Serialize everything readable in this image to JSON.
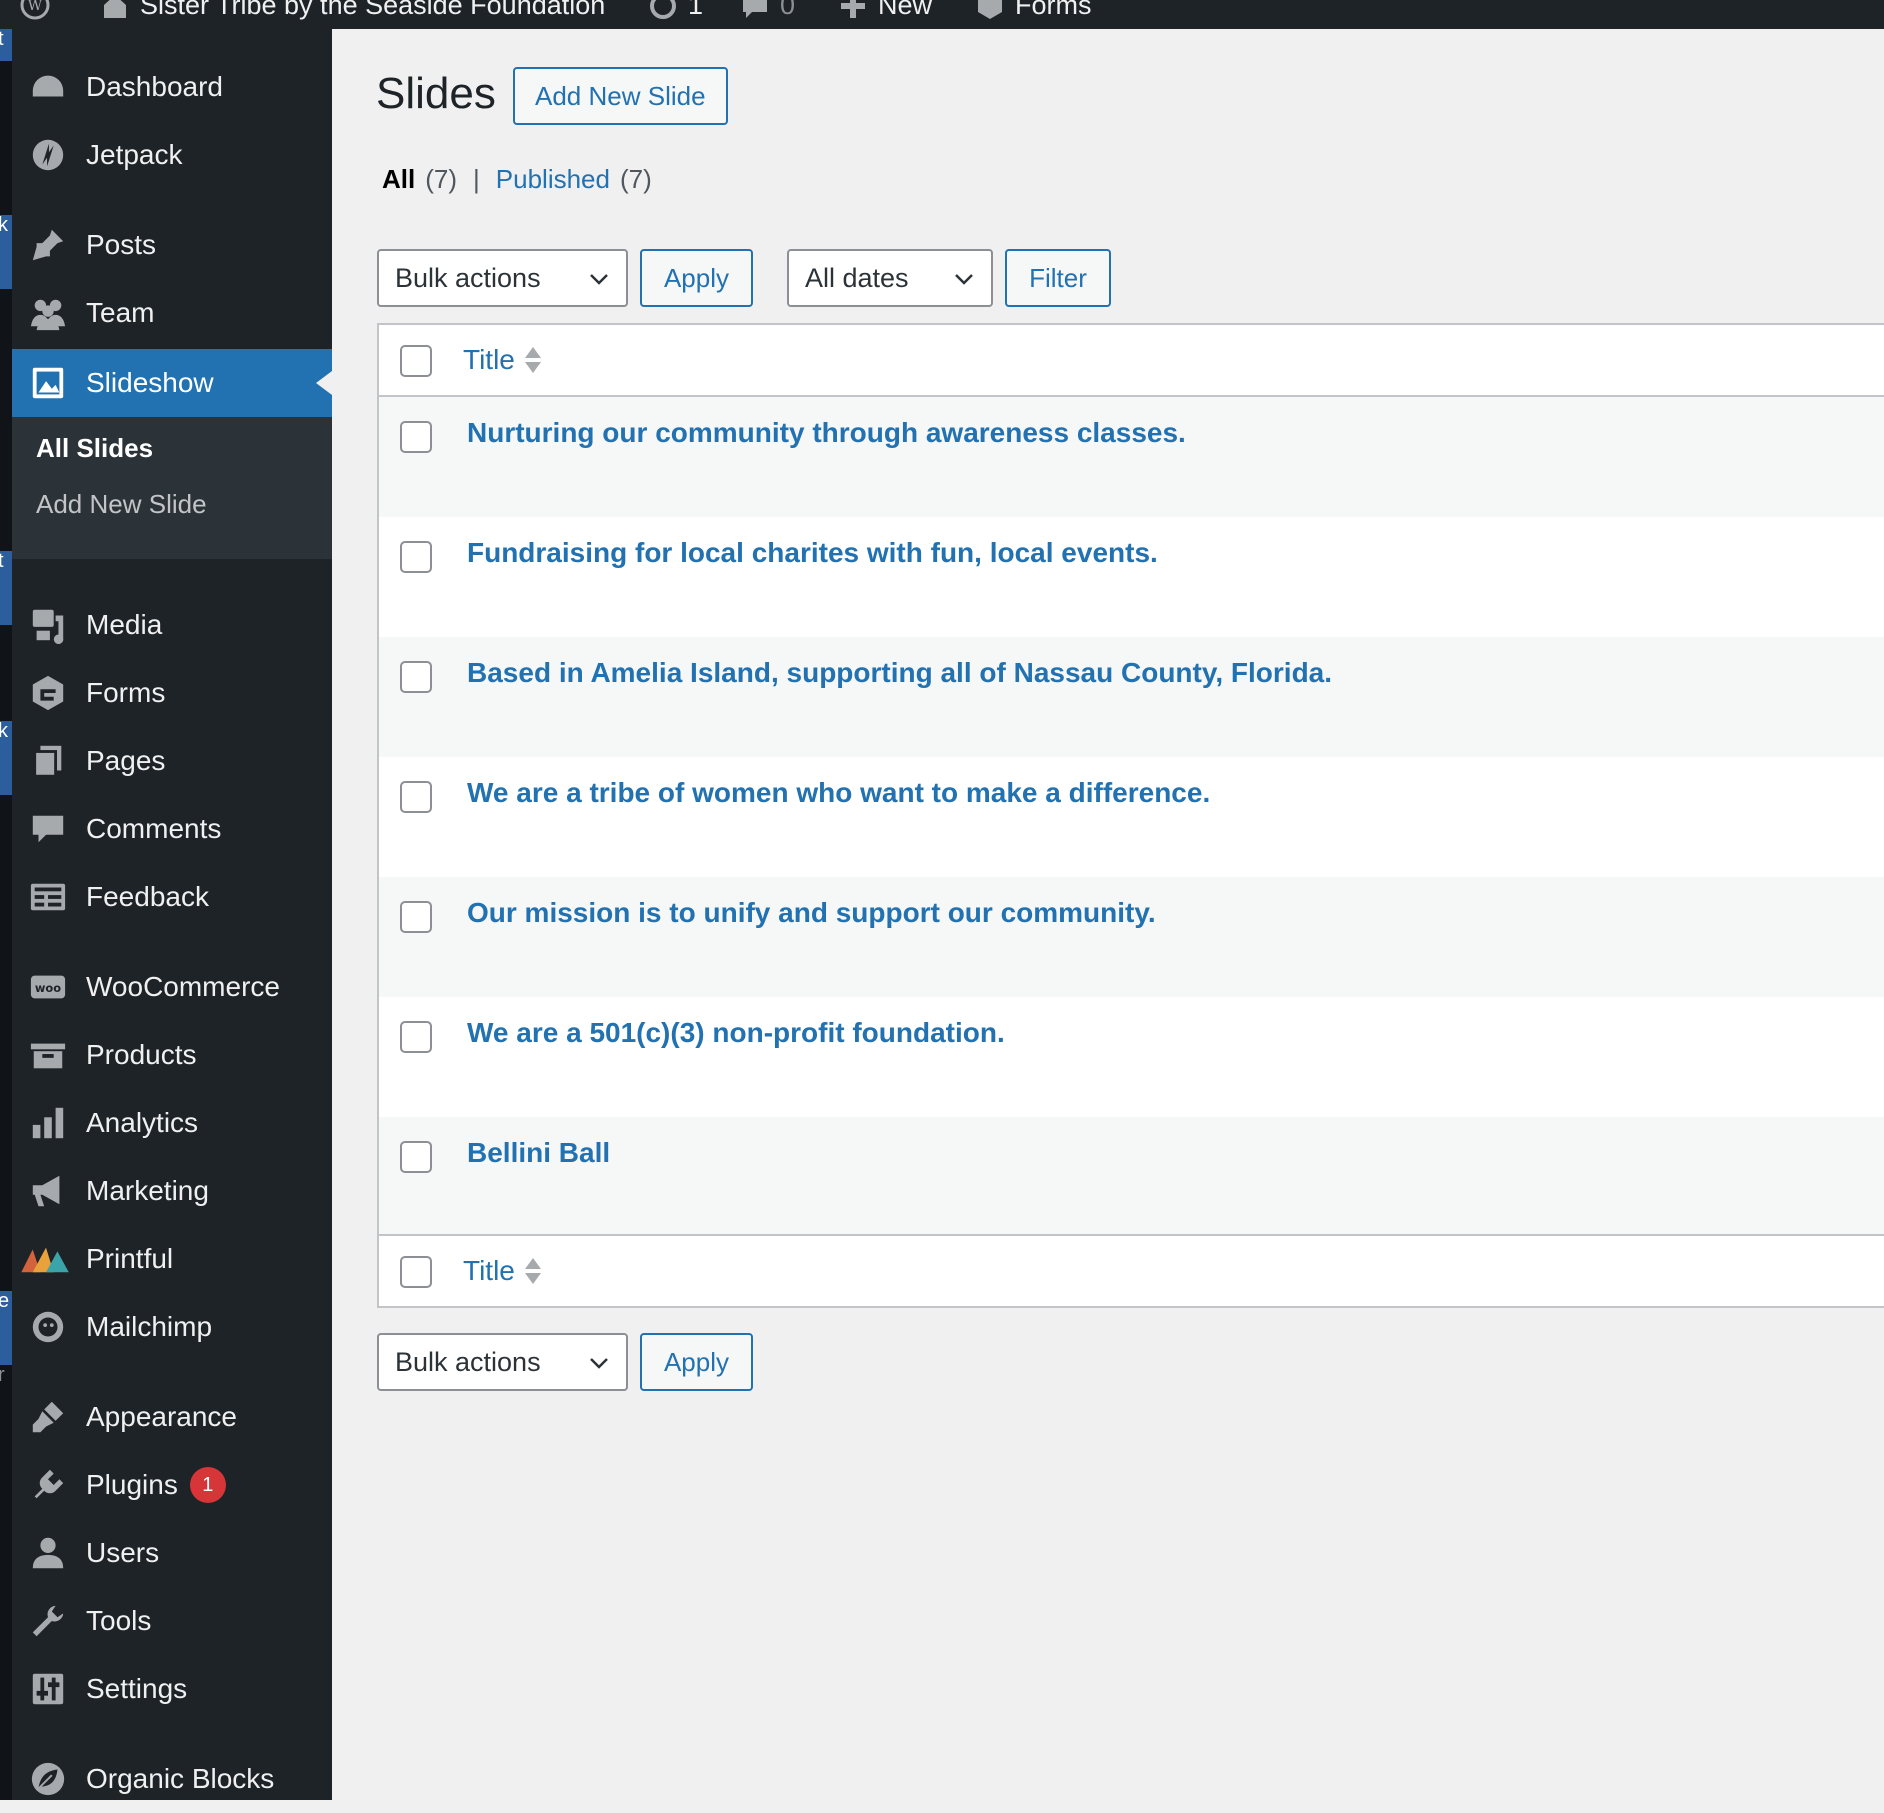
{
  "adminbar": {
    "site_name": "Sister Tribe by the Seaside Foundation",
    "updates_count": "1",
    "comments_count": "0",
    "new_label": "New",
    "forms_label": "Forms"
  },
  "leftstrip": [
    "t",
    "k",
    "t",
    "k",
    "e",
    "r"
  ],
  "sidebar": {
    "items": [
      {
        "label": "Dashboard",
        "icon": "dashboard-icon"
      },
      {
        "label": "Jetpack",
        "icon": "jetpack-icon"
      },
      {
        "label": "Posts",
        "icon": "pin-icon"
      },
      {
        "label": "Team",
        "icon": "team-icon"
      },
      {
        "label": "Slideshow",
        "icon": "slideshow-icon"
      },
      {
        "label": "Media",
        "icon": "media-icon"
      },
      {
        "label": "Forms",
        "icon": "forms-icon"
      },
      {
        "label": "Pages",
        "icon": "pages-icon"
      },
      {
        "label": "Comments",
        "icon": "comments-icon"
      },
      {
        "label": "Feedback",
        "icon": "feedback-icon"
      },
      {
        "label": "WooCommerce",
        "icon": "woo-icon"
      },
      {
        "label": "Products",
        "icon": "products-icon"
      },
      {
        "label": "Analytics",
        "icon": "analytics-icon"
      },
      {
        "label": "Marketing",
        "icon": "megaphone-icon"
      },
      {
        "label": "Printful",
        "icon": "printful-icon"
      },
      {
        "label": "Mailchimp",
        "icon": "mailchimp-icon"
      },
      {
        "label": "Appearance",
        "icon": "brush-icon"
      },
      {
        "label": "Plugins",
        "icon": "plugin-icon",
        "badge": "1"
      },
      {
        "label": "Users",
        "icon": "user-icon"
      },
      {
        "label": "Tools",
        "icon": "wrench-icon"
      },
      {
        "label": "Settings",
        "icon": "settings-icon"
      },
      {
        "label": "Organic Blocks",
        "icon": "leaf-icon"
      }
    ],
    "submenu": {
      "all_slides": "All Slides",
      "add_new_slide": "Add New Slide"
    }
  },
  "main": {
    "page_title": "Slides",
    "add_new_label": "Add New Slide",
    "filters": {
      "all_label": "All",
      "all_count": "(7)",
      "separator": "|",
      "published_label": "Published",
      "published_count": "(7)"
    },
    "bulk_actions": "Bulk actions",
    "apply_label": "Apply",
    "all_dates": "All dates",
    "filter_label": "Filter",
    "column_title": "Title",
    "rows": [
      "Nurturing our community through awareness classes.",
      "Fundraising for local charites with fun, local events.",
      "Based in Amelia Island, supporting all of Nassau County, Florida.",
      "We are a tribe of women who want to make a difference.",
      "Our mission is to unify and support our community.",
      "We are a 501(c)(3) non-profit foundation.",
      "Bellini Ball"
    ]
  },
  "colors": {
    "accent": "#2271b1",
    "sidebar_bg": "#1d2327",
    "badge": "#d63638"
  }
}
